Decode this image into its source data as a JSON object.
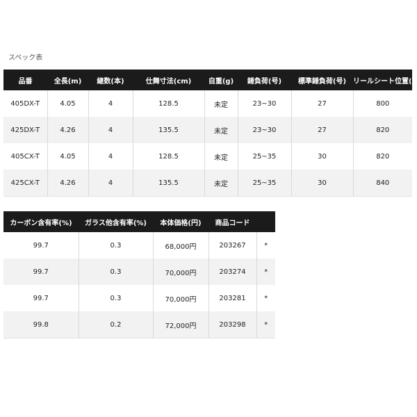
{
  "title": "スペック表",
  "table1": {
    "headers": [
      "品番",
      "全長(m)",
      "継数(本)",
      "仕舞寸法(cm)",
      "自重(g)",
      "錘負荷(号)",
      "標準錘負荷(号)",
      "リールシート位置(mm)"
    ],
    "rows": [
      [
        "405DX-T",
        "4.05",
        "4",
        "128.5",
        "未定",
        "23~30",
        "27",
        "800"
      ],
      [
        "425DX-T",
        "4.26",
        "4",
        "135.5",
        "未定",
        "23~30",
        "27",
        "820"
      ],
      [
        "405CX-T",
        "4.05",
        "4",
        "128.5",
        "未定",
        "25~35",
        "30",
        "820"
      ],
      [
        "425CX-T",
        "4.26",
        "4",
        "135.5",
        "未定",
        "25~35",
        "30",
        "840"
      ]
    ]
  },
  "table2": {
    "headers": [
      "カーボン含有率(%)",
      "ガラス他含有率(%)",
      "本体価格(円)",
      "商品コード",
      ""
    ],
    "rows": [
      [
        "99.7",
        "0.3",
        "68,000円",
        "203267",
        "*"
      ],
      [
        "99.7",
        "0.3",
        "70,000円",
        "203274",
        "*"
      ],
      [
        "99.7",
        "0.3",
        "70,000円",
        "203281",
        "*"
      ],
      [
        "99.8",
        "0.2",
        "72,000円",
        "203298",
        "*"
      ]
    ]
  }
}
